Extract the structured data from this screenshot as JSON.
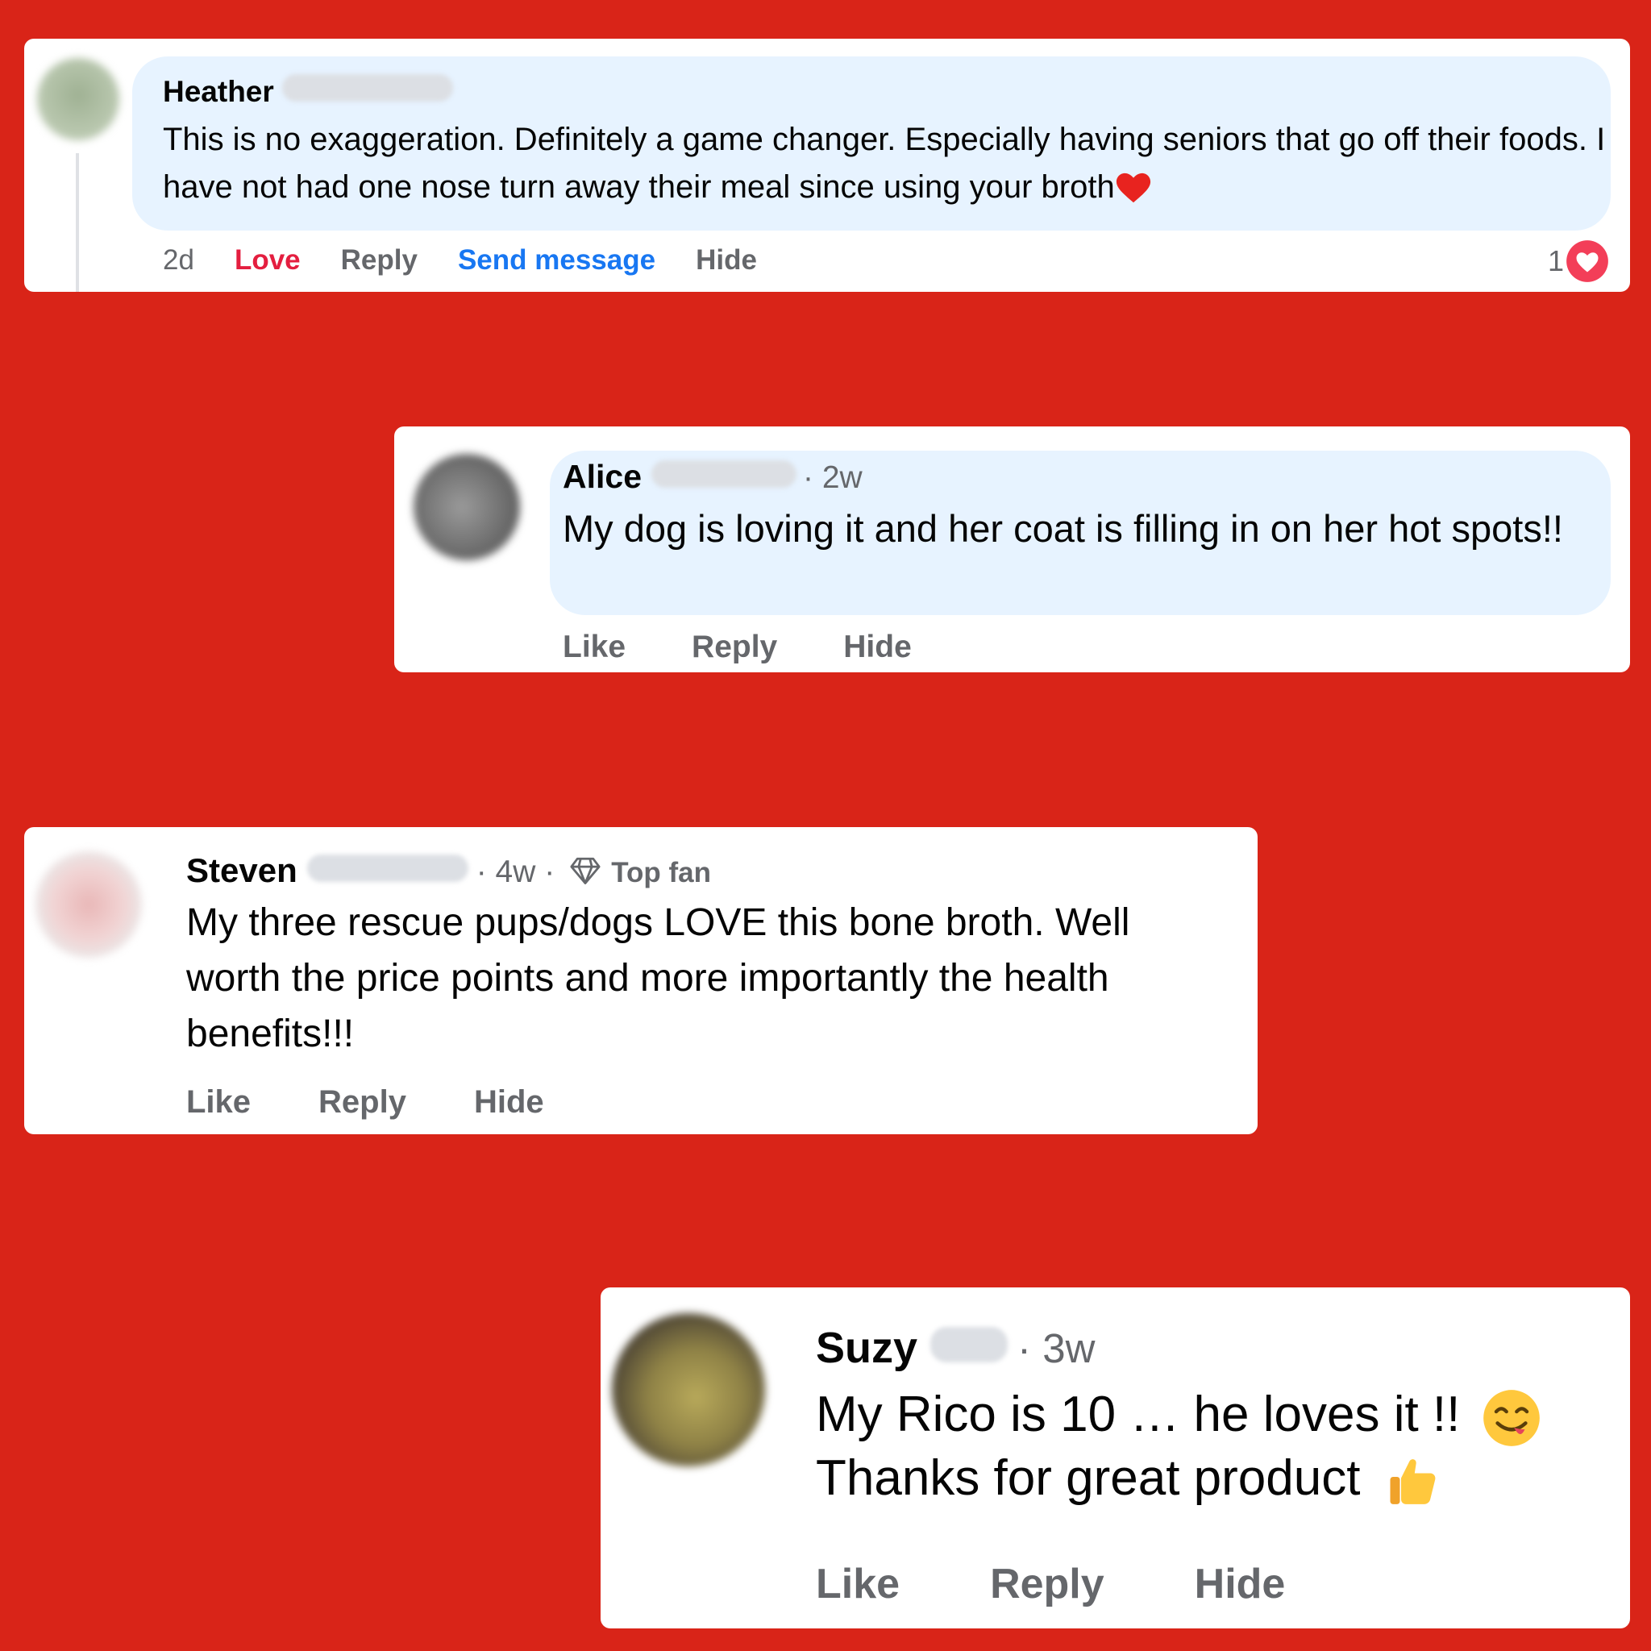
{
  "colors": {
    "background": "#d92418",
    "bubble": "#e7f3ff",
    "love": "#e41e3f",
    "link": "#1877f2",
    "meta": "#65676b"
  },
  "comments": [
    {
      "name": "Heather",
      "text": "This is no exaggeration. Definitely a game changer. Especially having seniors that go off their foods. I have not had one nose turn away their meal since using your broth",
      "time": "2d",
      "reaction_label": "Love",
      "reply": "Reply",
      "send_message": "Send message",
      "hide": "Hide",
      "reaction_count": "1",
      "emoji": "heart-emoji"
    },
    {
      "name": "Alice",
      "time": "· 2w",
      "text": "My dog is loving it and her coat is filling in on her hot spots!!",
      "like": "Like",
      "reply": "Reply",
      "hide": "Hide"
    },
    {
      "name": "Steven",
      "time": "· 4w ·",
      "badge": "Top fan",
      "badge_icon": "diamond-icon",
      "text": "My three rescue pups/dogs LOVE this bone broth. Well worth the price points and more importantly the health benefits!!!",
      "like": "Like",
      "reply": "Reply",
      "hide": "Hide"
    },
    {
      "name": "Suzy",
      "time": "· 3w",
      "line1": "My Rico is 10 … he loves it !!",
      "line2": "Thanks for great product",
      "emoji1": "savoring-face-emoji",
      "emoji2": "thumbs-up-emoji",
      "like": "Like",
      "reply": "Reply",
      "hide": "Hide"
    }
  ]
}
